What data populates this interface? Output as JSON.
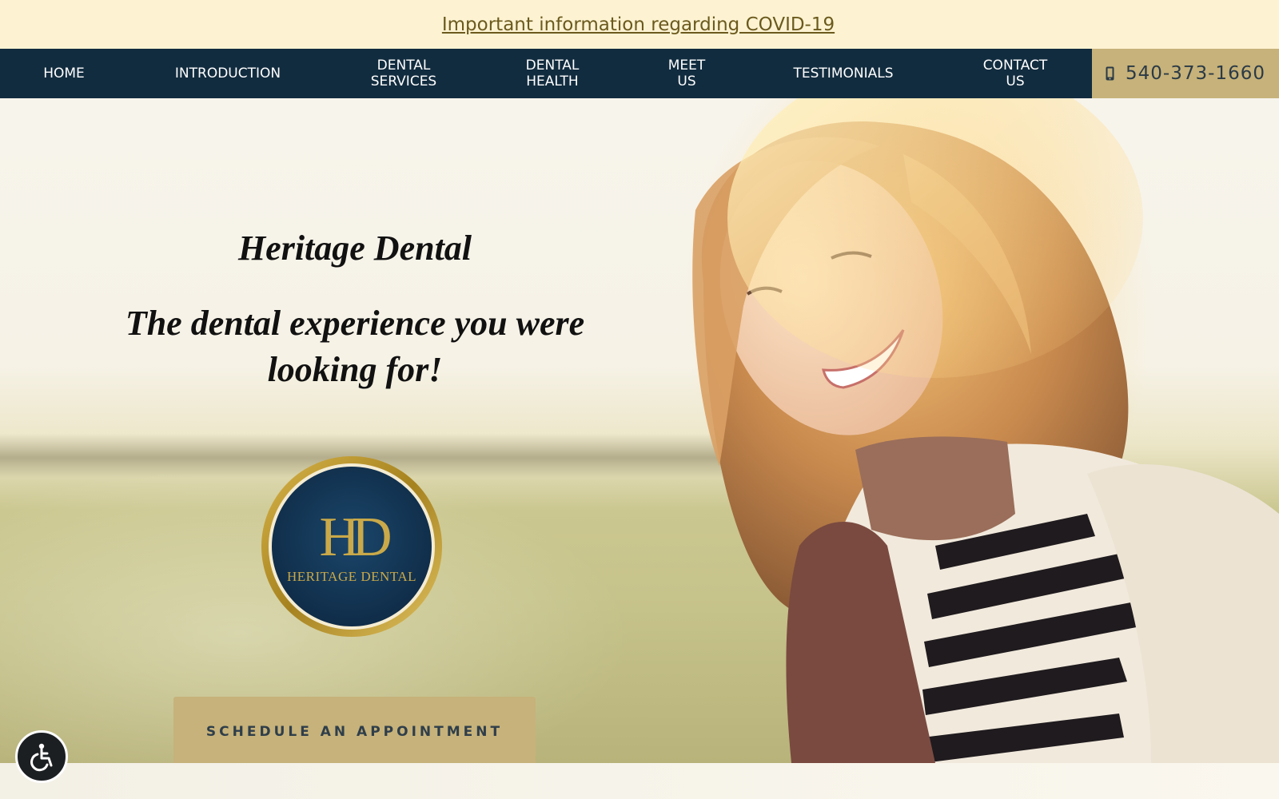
{
  "banner": {
    "link_text": "Important information regarding COVID-19"
  },
  "nav": {
    "items": [
      {
        "label": "HOME"
      },
      {
        "label": "INTRODUCTION"
      },
      {
        "label": "DENTAL\nSERVICES"
      },
      {
        "label": "DENTAL\nHEALTH"
      },
      {
        "label": "MEET\nUS"
      },
      {
        "label": "TESTIMONIALS"
      },
      {
        "label": "CONTACT\nUS"
      }
    ],
    "phone": {
      "icon": "mobile-phone-icon",
      "number": "540-373-1660"
    }
  },
  "hero": {
    "title": "Heritage Dental",
    "tagline": "The dental experience you were looking for!",
    "logo": {
      "monogram": "HD",
      "name": "HERITAGE DENTAL"
    },
    "cta_label": "SCHEDULE AN APPOINTMENT"
  },
  "accessibility": {
    "icon": "wheelchair-icon"
  },
  "colors": {
    "banner_bg": "#fdf3d2",
    "nav_bg": "#122c3f",
    "accent_gold": "#c6b27a",
    "text_dark": "#2f3e4a"
  }
}
